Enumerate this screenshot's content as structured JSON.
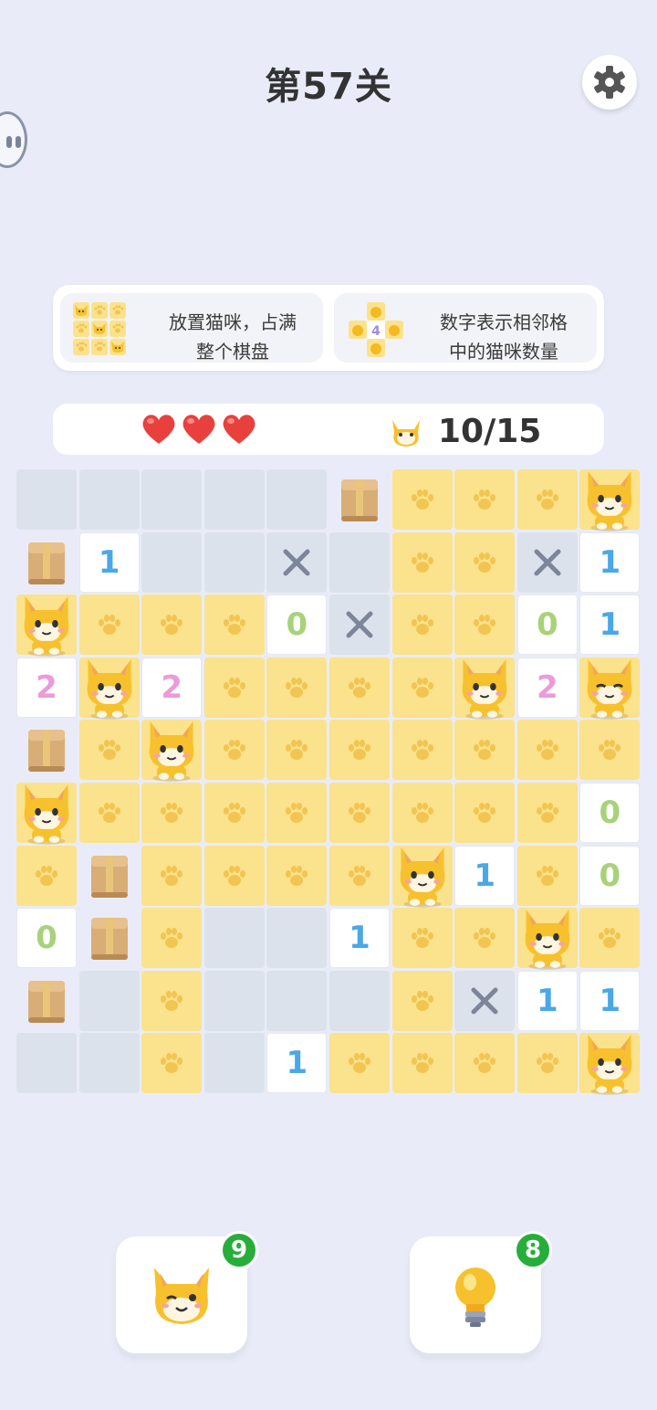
{
  "header": {
    "level_title": "第57关"
  },
  "rules": {
    "rule1": {
      "line1": "放置猫咪，占满",
      "line2": "整个棋盘"
    },
    "rule2": {
      "line1": "数字表示相邻格",
      "line2": "中的猫咪数量",
      "example_number": "4"
    }
  },
  "status": {
    "hearts": 3,
    "cats_placed": "10/15"
  },
  "board": {
    "rows": [
      [
        "empty",
        "empty",
        "empty",
        "empty",
        "empty",
        "box",
        "paw",
        "paw",
        "paw",
        "cat"
      ],
      [
        "box",
        "1",
        "empty",
        "empty",
        "x",
        "empty",
        "paw",
        "paw",
        "x",
        "1"
      ],
      [
        "cat",
        "paw",
        "paw",
        "paw",
        "0",
        "x",
        "paw",
        "paw",
        "0",
        "1"
      ],
      [
        "2",
        "cat",
        "2",
        "paw",
        "paw",
        "paw",
        "paw",
        "cat",
        "2",
        "cat-wink"
      ],
      [
        "box",
        "paw",
        "cat",
        "paw",
        "paw",
        "paw",
        "paw",
        "paw",
        "paw",
        "paw"
      ],
      [
        "cat",
        "paw",
        "paw",
        "paw",
        "paw",
        "paw",
        "paw",
        "paw",
        "paw",
        "0"
      ],
      [
        "paw",
        "box",
        "paw",
        "paw",
        "paw",
        "paw",
        "cat",
        "1",
        "paw",
        "0"
      ],
      [
        "0",
        "box",
        "paw",
        "empty",
        "empty",
        "1",
        "paw",
        "paw",
        "cat",
        "paw"
      ],
      [
        "box",
        "empty",
        "paw",
        "empty",
        "empty",
        "empty",
        "paw",
        "x",
        "1",
        "1"
      ],
      [
        "empty",
        "empty",
        "paw",
        "empty",
        "1",
        "paw",
        "paw",
        "paw",
        "paw",
        "cat"
      ]
    ]
  },
  "tools": {
    "cat_tool_count": "9",
    "hint_tool_count": "8"
  },
  "colors": {
    "background": "#e9ecf8",
    "paw_tile": "#fbe28c",
    "empty_tile": "#dce2ec",
    "badge": "#27ae3a",
    "heart": "#e8413d"
  }
}
